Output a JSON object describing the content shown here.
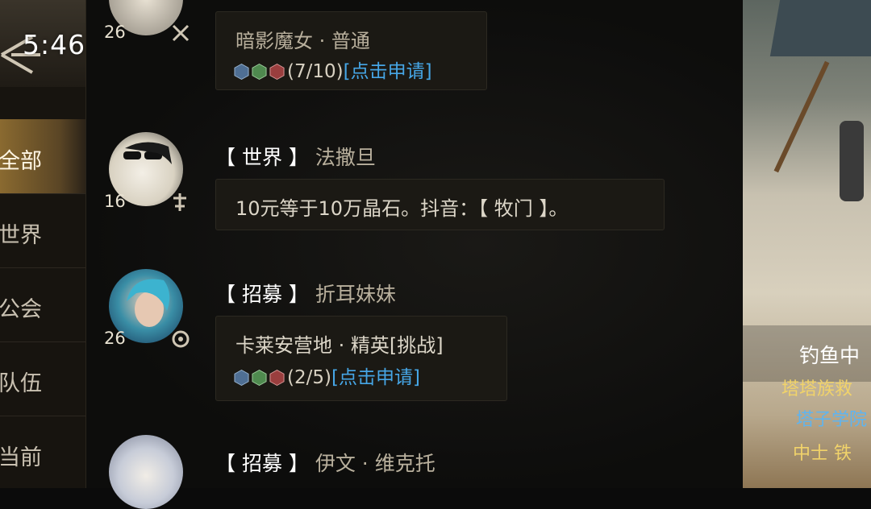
{
  "status": {
    "time": "5:46"
  },
  "tabs": [
    {
      "label": "全部",
      "active": true
    },
    {
      "label": "世界",
      "active": false
    },
    {
      "label": "公会",
      "active": false
    },
    {
      "label": "队伍",
      "active": false
    },
    {
      "label": "当前",
      "active": false
    }
  ],
  "messages": [
    {
      "level": "26",
      "dungeon": "暗影魔女 · 普通",
      "count": "(7/10)",
      "apply": "[点击申请]"
    },
    {
      "level": "16",
      "channel": "【 世界 】",
      "sender": "法撒旦",
      "text": "10元等于10万晶石。抖音：【 牧门 】。"
    },
    {
      "level": "26",
      "channel": "【 招募 】",
      "sender": "折耳妹妹",
      "dungeon": "卡莱安营地 · 精英[挑战]",
      "count": "(2/5)",
      "apply": "[点击申请]"
    },
    {
      "channel": "【 招募 】",
      "sender": "伊文 · 维克托"
    }
  ],
  "scene": {
    "status_text": "钓鱼中",
    "line1": "塔塔族救",
    "line2": "塔子学院",
    "line3": "中士  铁"
  },
  "colors": {
    "link": "#46a6e6",
    "active_tab": "#8a6a30",
    "scene_yellow": "#f1d36a",
    "scene_blue": "#5fb4ef"
  }
}
